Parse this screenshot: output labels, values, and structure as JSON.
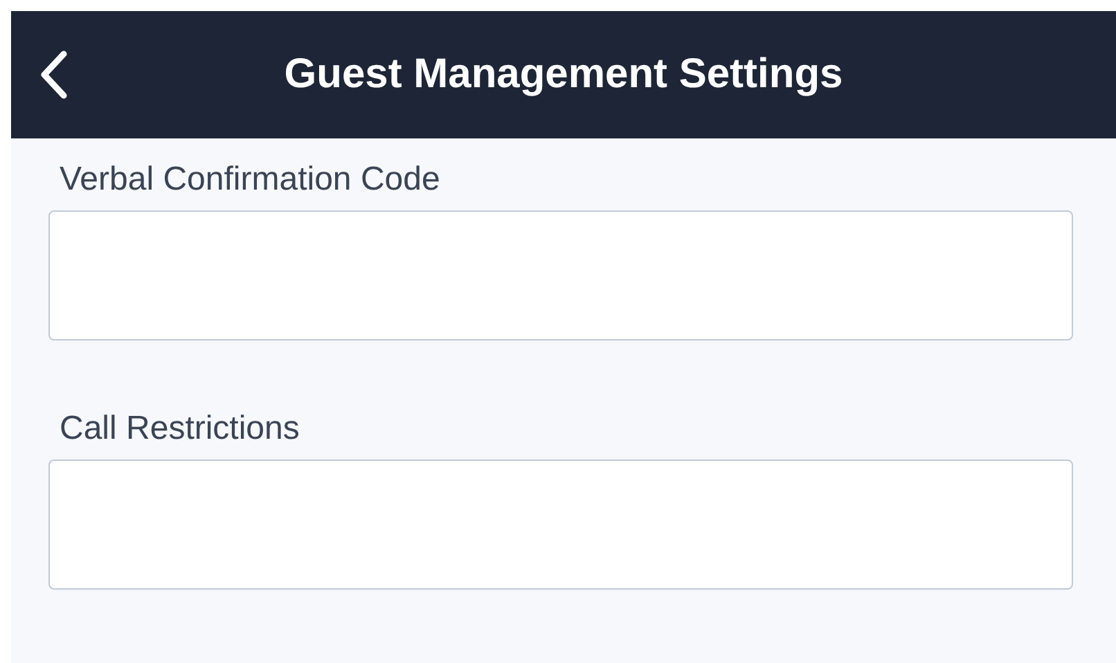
{
  "header": {
    "title": "Guest Management Settings"
  },
  "fields": [
    {
      "label": "Verbal Confirmation Code"
    },
    {
      "label": "Call Restrictions"
    }
  ]
}
